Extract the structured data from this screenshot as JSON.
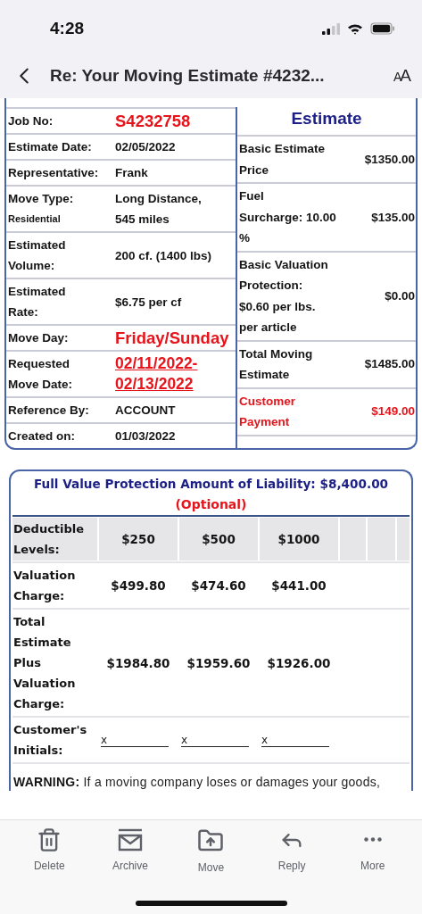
{
  "status_bar": {
    "time": "4:28"
  },
  "nav": {
    "title": "Re: Your Moving Estimate #4232...",
    "text_size": "AA"
  },
  "details": [
    {
      "label": "Job No:",
      "value": "S4232758",
      "kind": "highlight"
    },
    {
      "label": "Estimate Date:",
      "value": "02/05/2022",
      "kind": "plain"
    },
    {
      "label": "Representative:",
      "value": "Frank",
      "kind": "plain"
    },
    {
      "label": "Move Type:",
      "sublabel": "Residential",
      "value": "Long Distance,\n545 miles",
      "kind": "plain"
    },
    {
      "label": "Estimated\nVolume:",
      "value": "200 cf. (1400 lbs)",
      "kind": "plain"
    },
    {
      "label": "Estimated\nRate:",
      "value": "$6.75 per cf",
      "kind": "plain"
    },
    {
      "label": "Move Day:",
      "value": "Friday/Sunday",
      "kind": "highlight"
    },
    {
      "label": "Requested\nMove Date:",
      "value": "02/11/2022-\n02/13/2022",
      "kind": "link"
    },
    {
      "label": "Reference By:",
      "value": "ACCOUNT",
      "kind": "plain"
    },
    {
      "label": "Created on:",
      "value": "01/03/2022",
      "kind": "plain"
    }
  ],
  "estimate": {
    "title": "Estimate",
    "rows": [
      {
        "label": "Basic Estimate\nPrice",
        "value": "$1350.00",
        "kind": "plain"
      },
      {
        "label": "Fuel\nSurcharge: 10.00\n%",
        "value": "$135.00",
        "kind": "plain"
      },
      {
        "label": "Basic Valuation\nProtection:\n$0.60 per lbs.\nper article",
        "value": "$0.00",
        "kind": "plain"
      },
      {
        "label": "Total Moving\nEstimate",
        "value": "$1485.00",
        "kind": "plain"
      },
      {
        "label": "Customer\nPayment",
        "value": "$149.00",
        "kind": "highlight"
      }
    ]
  },
  "protection": {
    "title": "Full Value Protection Amount of Liability: $8,400.00",
    "note": "(Optional)",
    "rows": [
      {
        "kind": "header",
        "label": "Deductible\nLevels:",
        "cells": [
          "$250",
          "$500",
          "$1000"
        ]
      },
      {
        "kind": "values",
        "label": "Valuation\nCharge:",
        "cells": [
          "$499.80",
          "$474.60",
          "$441.00"
        ]
      },
      {
        "kind": "values",
        "label": "Total\nEstimate\nPlus\nValuation\nCharge:",
        "cells": [
          "$1984.80",
          "$1959.60",
          "$1926.00"
        ]
      },
      {
        "kind": "initials",
        "label": "Customer's\nInitials:",
        "cells": [
          "x",
          "x",
          "x"
        ]
      }
    ],
    "warning": "**WARNING:** If a moving company loses or damages your goods,"
  },
  "toolbar": [
    {
      "label": "Delete"
    },
    {
      "label": "Archive"
    },
    {
      "label": "Move"
    },
    {
      "label": "Reply"
    },
    {
      "label": "More"
    }
  ]
}
